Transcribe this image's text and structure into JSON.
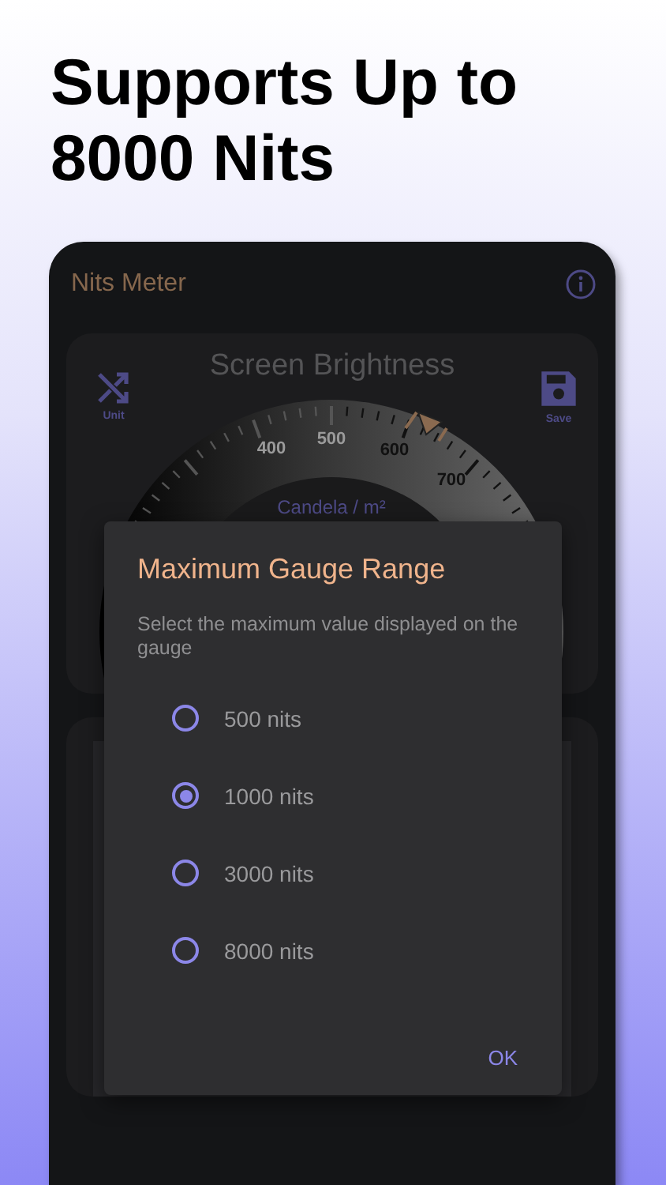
{
  "headline": "Supports Up to 8000 Nits",
  "app": {
    "title": "Nits Meter"
  },
  "gauge": {
    "title": "Screen Brightness",
    "unit_button": "Unit",
    "save_button": "Save",
    "scale_labels": [
      "400",
      "500",
      "600",
      "700"
    ],
    "unit": "Candela / m²"
  },
  "dialog": {
    "title": "Maximum Gauge Range",
    "message": "Select the maximum value displayed on the gauge",
    "options": [
      {
        "label": "500 nits",
        "selected": false
      },
      {
        "label": "1000 nits",
        "selected": true
      },
      {
        "label": "3000 nits",
        "selected": false
      },
      {
        "label": "8000 nits",
        "selected": false
      }
    ],
    "buttons": [
      "OK"
    ]
  }
}
